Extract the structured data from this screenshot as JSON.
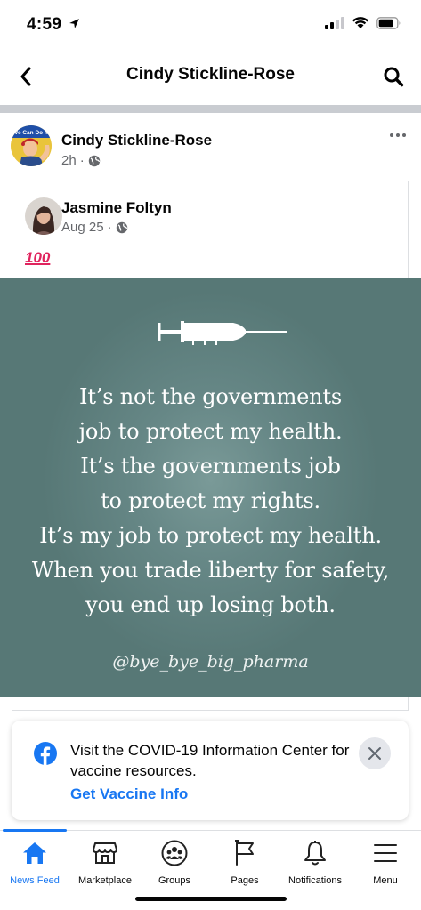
{
  "status_bar": {
    "time": "4:59"
  },
  "header": {
    "title": "Cindy Stickline-Rose"
  },
  "post": {
    "author": "Cindy Stickline-Rose",
    "time": "2h",
    "avatar_text": "We Can Do It!",
    "shared": {
      "author": "Jasmine Foltyn",
      "date": "Aug 25",
      "emoji_text": "100",
      "quote_lines": [
        "It’s not the governments",
        "job to protect my health.",
        "It’s the governments job",
        "to protect my rights.",
        "It’s my job to protect my health.",
        "When you trade liberty for safety,",
        "you end up losing both."
      ],
      "credit": "@bye_bye_big_pharma"
    }
  },
  "covid_card": {
    "message": "Visit the COVID-19 Information Center for vaccine resources.",
    "link": "Get Vaccine Info"
  },
  "tabs": [
    {
      "label": "News Feed",
      "icon": "home-icon",
      "active": true
    },
    {
      "label": "Marketplace",
      "icon": "marketplace-icon"
    },
    {
      "label": "Groups",
      "icon": "groups-icon"
    },
    {
      "label": "Pages",
      "icon": "pages-flag-icon"
    },
    {
      "label": "Notifications",
      "icon": "bell-icon"
    },
    {
      "label": "Menu",
      "icon": "menu-icon"
    }
  ],
  "colors": {
    "accent": "#1877f2",
    "image_bg": "#5f807f",
    "secondary_text": "#65676b"
  }
}
